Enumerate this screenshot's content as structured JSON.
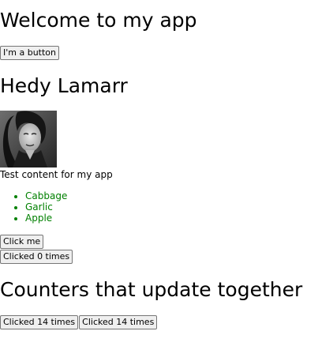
{
  "app": {
    "welcome_heading": "Welcome to my app",
    "main_button_label": "I'm a button"
  },
  "profile": {
    "name": "Hedy Lamarr",
    "photo_icon": "portrait-photo"
  },
  "content": {
    "text": "Test content for my app",
    "products": [
      {
        "title": "Cabbage",
        "color": "#008000"
      },
      {
        "title": "Garlic",
        "color": "#008000"
      },
      {
        "title": "Apple",
        "color": "#008000"
      }
    ]
  },
  "buttons": {
    "click_me_label": "Click me",
    "counter_label": "Clicked 0 times"
  },
  "shared_counters": {
    "heading": "Counters that update together",
    "first_label": "Clicked 14 times",
    "second_label": "Clicked 14 times"
  },
  "colors": {
    "product_text": "#008000",
    "button_bg": "#efefef",
    "button_border": "#767676"
  }
}
